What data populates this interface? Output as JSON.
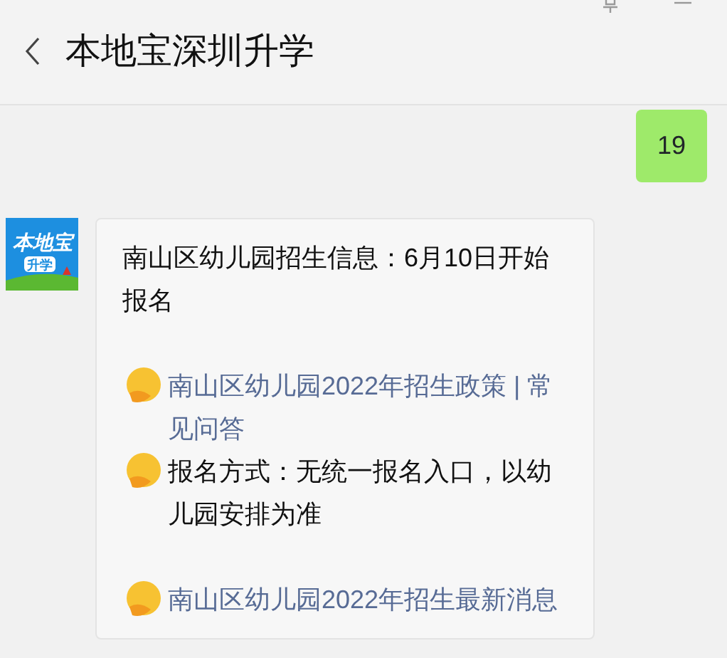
{
  "header": {
    "title": "本地宝深圳升学"
  },
  "messages": [
    {
      "kind": "sent",
      "text": "19"
    },
    {
      "kind": "received",
      "avatar": {
        "logo": "本地宝",
        "tag": "升学"
      },
      "paragraphs": [
        {
          "lines": [
            {
              "kind": "text",
              "emoji": false,
              "text": "南山区幼儿园招生信息：6月10日开始报名"
            }
          ]
        },
        {
          "lines": [
            {
              "kind": "link",
              "emoji": true,
              "text": "南山区幼儿园2022年招生政策 | 常见问答"
            },
            {
              "kind": "text",
              "emoji": true,
              "text": "报名方式：无统一报名入口，以幼儿园安排为准"
            }
          ]
        },
        {
          "lines": [
            {
              "kind": "link",
              "emoji": true,
              "text": "南山区幼儿园2022年招生最新消息"
            }
          ]
        }
      ]
    }
  ]
}
